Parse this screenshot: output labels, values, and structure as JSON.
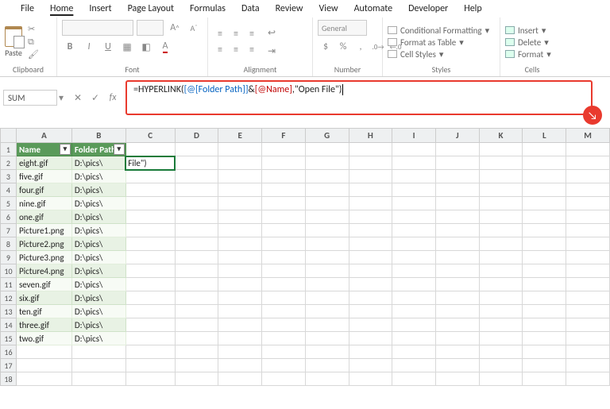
{
  "menu": [
    "File",
    "Home",
    "Insert",
    "Page Layout",
    "Formulas",
    "Data",
    "Review",
    "View",
    "Automate",
    "Developer",
    "Help"
  ],
  "menu_active_index": 1,
  "ribbon": {
    "clipboard": {
      "paste": "Paste",
      "label": "Clipboard"
    },
    "font": {
      "label": "Font",
      "bold": "B",
      "italic": "I",
      "underline": "U",
      "inc": "A",
      "dec": "A"
    },
    "alignment": {
      "label": "Alignment"
    },
    "number": {
      "label": "Number",
      "format": "General"
    },
    "styles": {
      "label": "Styles",
      "cond": "Conditional Formatting",
      "table": "Format as Table",
      "cell": "Cell Styles"
    },
    "cells": {
      "label": "Cells",
      "insert": "Insert",
      "delete": "Delete",
      "format": "Format"
    }
  },
  "namebox": "SUM",
  "fxlabel": "fx",
  "formula": {
    "pre": "=HYPERLINK(",
    "f1_open": "[@[",
    "f1_name": "Folder Path",
    "f1_close": "]]",
    "amp": "&",
    "f2_open": "[@",
    "f2_name": "Name",
    "f2_close": "]",
    "post": ",\"Open File\")"
  },
  "columns": [
    "A",
    "B",
    "C",
    "D",
    "E",
    "F",
    "G",
    "H",
    "I",
    "J",
    "K",
    "L",
    "M"
  ],
  "table_headers": {
    "name": "Name",
    "path": "Folder Path"
  },
  "c2": "File\")",
  "rows": [
    {
      "n": "eight.gif",
      "p": "D:\\pics\\"
    },
    {
      "n": "five.gif",
      "p": "D:\\pics\\"
    },
    {
      "n": "four.gif",
      "p": "D:\\pics\\"
    },
    {
      "n": "nine.gif",
      "p": "D:\\pics\\"
    },
    {
      "n": "one.gif",
      "p": "D:\\pics\\"
    },
    {
      "n": "Picture1.png",
      "p": "D:\\pics\\"
    },
    {
      "n": "Picture2.png",
      "p": "D:\\pics\\"
    },
    {
      "n": "Picture3.png",
      "p": "D:\\pics\\"
    },
    {
      "n": "Picture4.png",
      "p": "D:\\pics\\"
    },
    {
      "n": "seven.gif",
      "p": "D:\\pics\\"
    },
    {
      "n": "six.gif",
      "p": "D:\\pics\\"
    },
    {
      "n": "ten.gif",
      "p": "D:\\pics\\"
    },
    {
      "n": "three.gif",
      "p": "D:\\pics\\"
    },
    {
      "n": "two.gif",
      "p": "D:\\pics\\"
    }
  ]
}
